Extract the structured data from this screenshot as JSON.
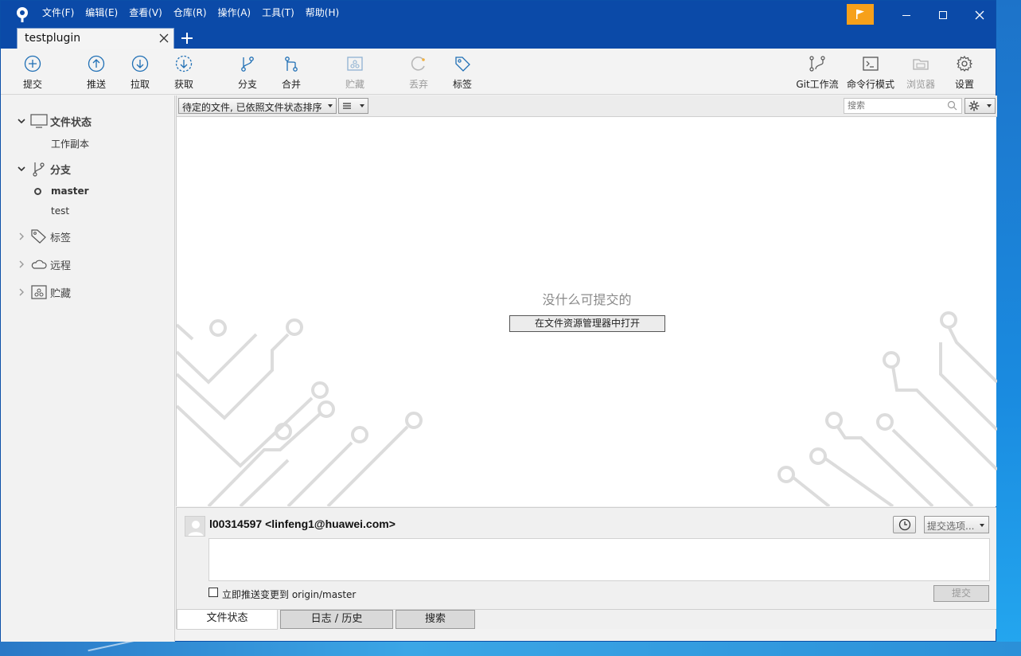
{
  "menu": [
    "文件(F)",
    "编辑(E)",
    "查看(V)",
    "仓库(R)",
    "操作(A)",
    "工具(T)",
    "帮助(H)"
  ],
  "tab": {
    "title": "testplugin"
  },
  "toolbar": {
    "commit": "提交",
    "push": "推送",
    "pull": "拉取",
    "fetch": "获取",
    "branch": "分支",
    "merge": "合并",
    "stash": "贮藏",
    "discard": "丢弃",
    "tag": "标签",
    "gitflow": "Git工作流",
    "terminal": "命令行模式",
    "explorer": "浏览器",
    "settings": "设置"
  },
  "sidebar": {
    "file_status": "文件状态",
    "working_copy": "工作副本",
    "branches": "分支",
    "branch_items": [
      "master",
      "test"
    ],
    "tags": "标签",
    "remotes": "远程",
    "stashes": "贮藏"
  },
  "filter": {
    "sort_label": "待定的文件, 已依照文件状态排序",
    "search_placeholder": "搜索"
  },
  "main": {
    "empty_message": "没什么可提交的",
    "open_explorer": "在文件资源管理器中打开"
  },
  "commit": {
    "author": "l00314597 <linfeng1@huawei.com>",
    "options": "提交选项...",
    "push_label": "立即推送变更到 origin/master",
    "push_checked": false,
    "commit_button": "提交"
  },
  "bottom_tabs": [
    "文件状态",
    "日志 / 历史",
    "搜索"
  ],
  "colors": {
    "titlebar": "#0b4aa8",
    "flag": "#f6a01a",
    "icon": "#1f6fb5"
  }
}
